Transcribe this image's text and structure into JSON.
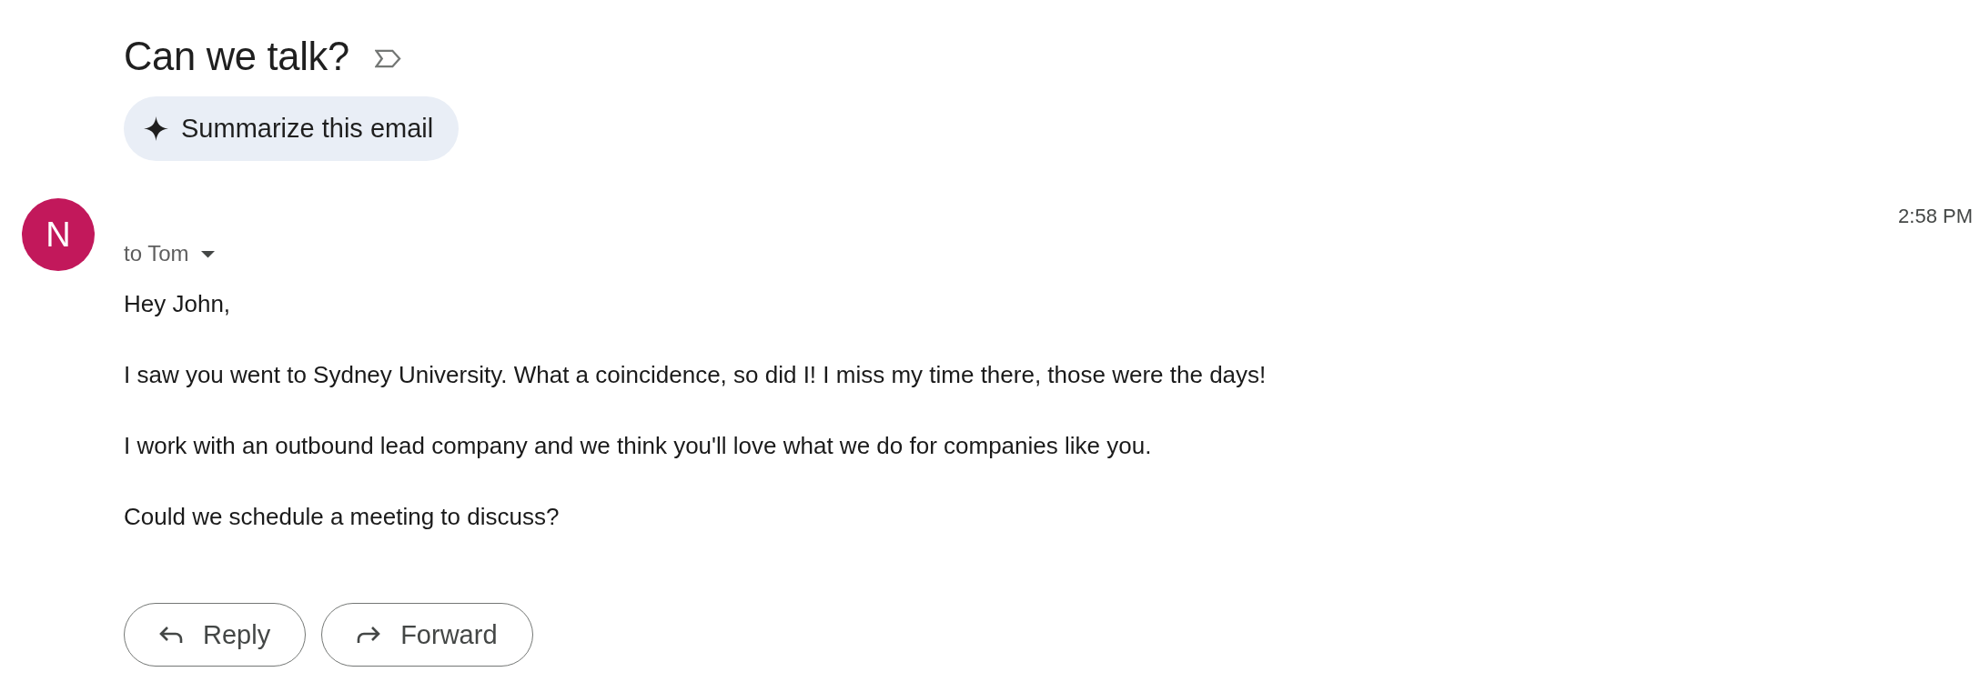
{
  "subject": {
    "title": "Can we talk?"
  },
  "summarize_button": {
    "label": "Summarize this email"
  },
  "message": {
    "avatar": {
      "initial": "N"
    },
    "time": "2:58 PM",
    "recipients": "to Tom",
    "body": [
      "Hey John,",
      "I saw you went to Sydney University. What a coincidence, so did I! I miss my time there, those were the days!",
      "I work with an outbound lead company and we think you'll love what we do for companies like you.",
      "Could we schedule a meeting to discuss?"
    ]
  },
  "actions": [
    {
      "kind": "reply",
      "label": "Reply"
    },
    {
      "kind": "forward",
      "label": "Forward"
    }
  ]
}
